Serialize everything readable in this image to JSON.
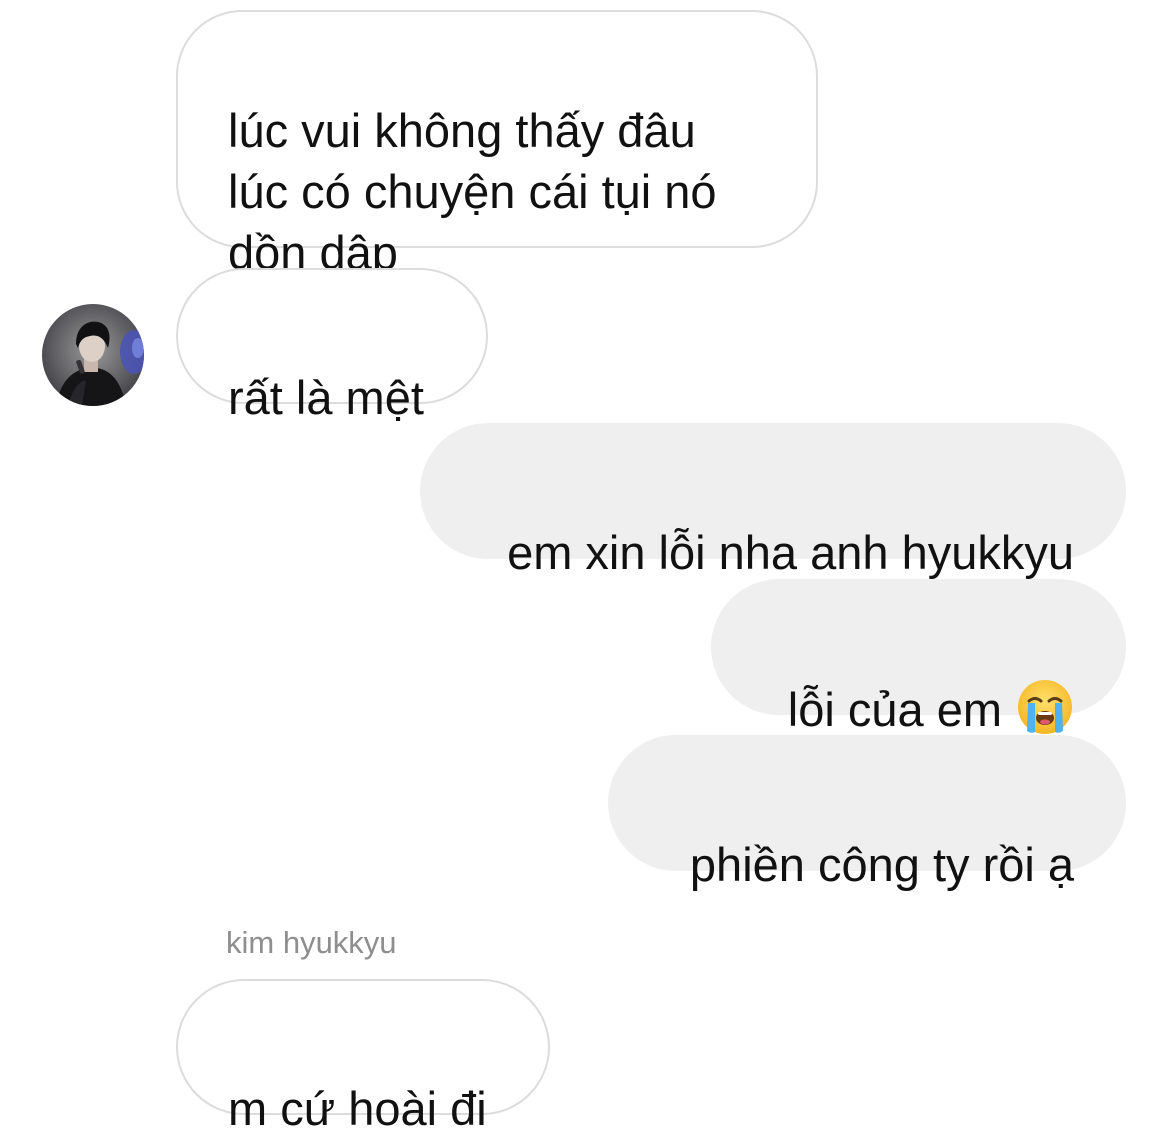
{
  "conversation": {
    "messages": [
      {
        "text": "lúc vui không thấy đâu\nlúc có chuyện cái tụi nó\ndồn dập",
        "direction": "incoming"
      },
      {
        "text": "rất là mệt",
        "direction": "incoming"
      },
      {
        "text": "em xin lỗi nha anh hyukkyu",
        "direction": "outgoing"
      },
      {
        "text": "lỗi của em",
        "direction": "outgoing",
        "emoji": "loudly-crying-face-emoji"
      },
      {
        "text": "phiền công ty rồi ạ",
        "direction": "outgoing"
      },
      {
        "text": "m cứ hoài đi",
        "direction": "incoming"
      }
    ],
    "sender_name": "kim hyukkyu"
  },
  "colors": {
    "incoming_bubble_bg": "#ffffff",
    "incoming_bubble_border": "#dcdcdc",
    "outgoing_bubble_bg": "#efefef",
    "text": "#111111",
    "sender_name": "#8e8e8e"
  },
  "avatar": {
    "icon": "user-avatar-photo"
  }
}
